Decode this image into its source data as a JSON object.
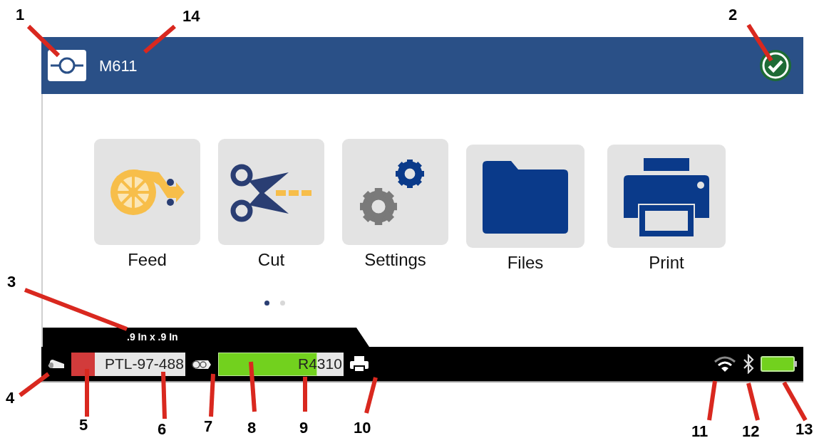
{
  "header": {
    "title": "M611"
  },
  "apps": [
    {
      "label": "Feed",
      "kind": "feed"
    },
    {
      "label": "Cut",
      "kind": "cut"
    },
    {
      "label": "Settings",
      "kind": "settings"
    },
    {
      "label": "Files",
      "kind": "files"
    },
    {
      "label": "Print",
      "kind": "print"
    }
  ],
  "pager": [
    {
      "selected": true
    },
    {
      "selected": false
    }
  ],
  "status_bar": {
    "label_size": ".9 In x .9 In",
    "label_media": {
      "name": "PTL-97-488",
      "color": "#d23b3b"
    },
    "ribbon": {
      "name": "R4310",
      "level": 0.79
    }
  },
  "callouts": [
    {
      "number": "1"
    },
    {
      "number": "14"
    },
    {
      "number": "2"
    },
    {
      "number": "3"
    },
    {
      "number": "4"
    },
    {
      "number": "5"
    },
    {
      "number": "6"
    },
    {
      "number": "7"
    },
    {
      "number": "8"
    },
    {
      "number": "9"
    },
    {
      "number": "10"
    },
    {
      "number": "11"
    },
    {
      "number": "12"
    },
    {
      "number": "13"
    }
  ]
}
